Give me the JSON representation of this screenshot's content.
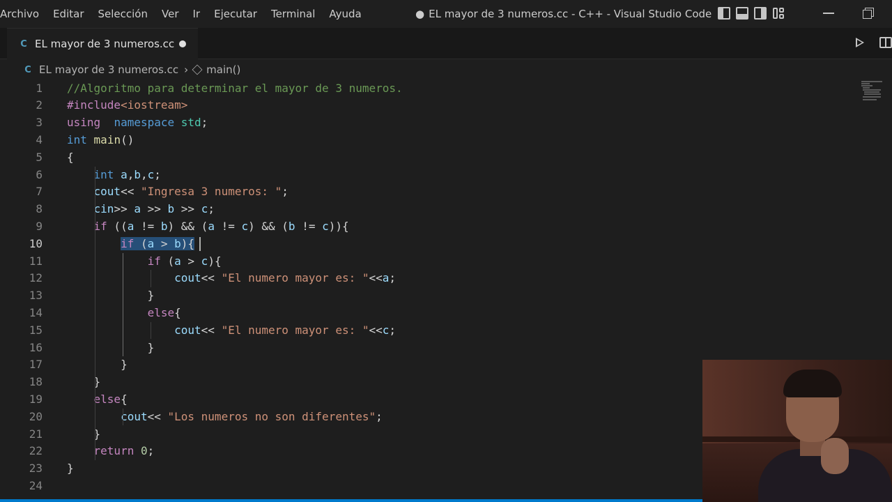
{
  "menu": [
    "Archivo",
    "Editar",
    "Selección",
    "Ver",
    "Ir",
    "Ejecutar",
    "Terminal",
    "Ayuda"
  ],
  "window_title": "EL mayor de 3 numeros.cc - C++ - Visual Studio Code",
  "window_title_dirty_marker": "●",
  "tab": {
    "label": "EL mayor de 3 numeros.cc",
    "icon": "C"
  },
  "breadcrumb": {
    "file": "EL mayor de 3 numeros.cc",
    "sep": "›",
    "symbol": "main()"
  },
  "editor": {
    "active_line": 10,
    "lines": [
      [
        [
          "t-cm",
          "//Algoritmo para determinar el mayor de 3 numeros."
        ]
      ],
      [
        [
          "t-pp",
          "#include"
        ],
        [
          "t-str",
          "<iostream>"
        ]
      ],
      [
        [
          "t-pp",
          "using"
        ],
        [
          "",
          "  "
        ],
        [
          "t-kw",
          "namespace"
        ],
        [
          "",
          ""
        ],
        [
          "t-ty",
          " std"
        ],
        [
          "",
          ";"
        ]
      ],
      [
        [
          "t-kw",
          "int"
        ],
        [
          "",
          " "
        ],
        [
          "t-fn",
          "main"
        ],
        [
          "",
          "()"
        ]
      ],
      [
        [
          "",
          "{"
        ]
      ],
      [
        [
          "",
          "    "
        ],
        [
          "t-kw",
          "int"
        ],
        [
          "",
          " "
        ],
        [
          "t-var",
          "a"
        ],
        [
          "",
          ","
        ],
        [
          "t-var",
          "b"
        ],
        [
          "",
          ","
        ],
        [
          "t-var",
          "c"
        ],
        [
          "",
          ";"
        ]
      ],
      [
        [
          "",
          "    "
        ],
        [
          "t-var",
          "cout"
        ],
        [
          "",
          "<< "
        ],
        [
          "t-str",
          "\"Ingresa 3 numeros: \""
        ],
        [
          "",
          ";"
        ]
      ],
      [
        [
          "",
          "    "
        ],
        [
          "t-var",
          "cin"
        ],
        [
          "",
          ">> "
        ],
        [
          "t-var",
          "a"
        ],
        [
          "",
          " >> "
        ],
        [
          "t-var",
          "b"
        ],
        [
          "",
          " >> "
        ],
        [
          "t-var",
          "c"
        ],
        [
          "",
          ";"
        ]
      ],
      [
        [
          "",
          "    "
        ],
        [
          "t-ctrl",
          "if"
        ],
        [
          "",
          " (("
        ],
        [
          "t-var",
          "a"
        ],
        [
          "",
          " != "
        ],
        [
          "t-var",
          "b"
        ],
        [
          "",
          ") && ("
        ],
        [
          "t-var",
          "a"
        ],
        [
          "",
          " != "
        ],
        [
          "t-var",
          "c"
        ],
        [
          "",
          ") && ("
        ],
        [
          "t-var",
          "b"
        ],
        [
          "",
          " != "
        ],
        [
          "t-var",
          "c"
        ],
        [
          "",
          "))"
        ],
        [
          "",
          "{"
        ]
      ],
      [
        [
          "",
          "        "
        ],
        [
          "sel t-ctrl",
          "if"
        ],
        [
          "sel",
          " ("
        ],
        [
          "sel t-var",
          "a"
        ],
        [
          "sel",
          " > "
        ],
        [
          "sel t-var",
          "b"
        ],
        [
          "sel",
          "){"
        ]
      ],
      [
        [
          "",
          "            "
        ],
        [
          "t-ctrl",
          "if"
        ],
        [
          "",
          " ("
        ],
        [
          "t-var",
          "a"
        ],
        [
          "",
          " > "
        ],
        [
          "t-var",
          "c"
        ],
        [
          "",
          "){"
        ]
      ],
      [
        [
          "",
          "                "
        ],
        [
          "t-var",
          "cout"
        ],
        [
          "",
          "<< "
        ],
        [
          "t-str",
          "\"El numero mayor es: \""
        ],
        [
          "",
          "<<"
        ],
        [
          "t-var",
          "a"
        ],
        [
          "",
          ";"
        ]
      ],
      [
        [
          "",
          "            }"
        ]
      ],
      [
        [
          "",
          "            "
        ],
        [
          "t-ctrl",
          "else"
        ],
        [
          "",
          "{"
        ]
      ],
      [
        [
          "",
          "                "
        ],
        [
          "t-var",
          "cout"
        ],
        [
          "",
          "<< "
        ],
        [
          "t-str",
          "\"El numero mayor es: \""
        ],
        [
          "",
          "<<"
        ],
        [
          "t-var",
          "c"
        ],
        [
          "",
          ";"
        ]
      ],
      [
        [
          "",
          "            }"
        ]
      ],
      [
        [
          "",
          "        }"
        ]
      ],
      [
        [
          "",
          "    }"
        ]
      ],
      [
        [
          "",
          "    "
        ],
        [
          "t-ctrl",
          "else"
        ],
        [
          "",
          "{"
        ]
      ],
      [
        [
          "",
          "        "
        ],
        [
          "t-var",
          "cout"
        ],
        [
          "",
          "<< "
        ],
        [
          "t-str",
          "\"Los numeros no son diferentes\""
        ],
        [
          "",
          ";"
        ]
      ],
      [
        [
          "",
          "    }"
        ]
      ],
      [
        [
          "",
          "    "
        ],
        [
          "t-ctrl",
          "return"
        ],
        [
          "",
          " "
        ],
        [
          "t-num",
          "0"
        ],
        [
          "",
          ";"
        ]
      ],
      [
        [
          "",
          "}"
        ]
      ],
      [
        [
          "",
          ""
        ]
      ]
    ]
  },
  "colors": {
    "background": "#1e1e1e",
    "selection": "#264f78",
    "accent": "#007acc"
  },
  "icons": [
    "cpp-file-icon",
    "run-icon",
    "split-editor-icon",
    "symbol-method-icon",
    "layout-icons",
    "minimize-icon",
    "restore-icon"
  ]
}
